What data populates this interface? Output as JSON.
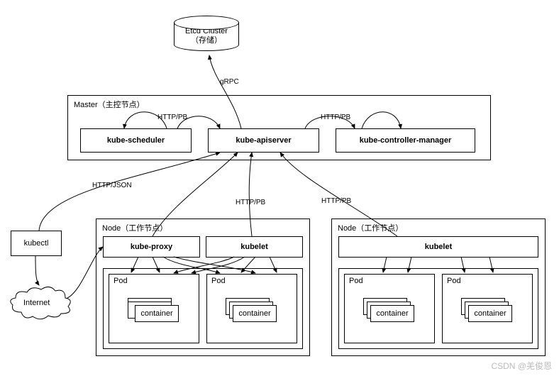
{
  "etcd": {
    "line1": "Etcd Cluster",
    "line2": "（存储）"
  },
  "master": {
    "title": "Master（主控节点）",
    "scheduler": "kube-scheduler",
    "apiserver": "kube-apiserver",
    "controller": "kube-controller-manager"
  },
  "edges": {
    "grpc": "gRPC",
    "httppb": "HTTP/PB",
    "httpjson": "HTTP/JSON"
  },
  "kubectl": "kubectl",
  "internet": "Internet",
  "node1": {
    "title": "Node（工作节点）",
    "proxy": "kube-proxy",
    "kubelet": "kubelet",
    "pod": "Pod",
    "container": "container"
  },
  "node2": {
    "title": "Node（工作节点）",
    "kubelet": "kubelet",
    "pod": "Pod",
    "container": "container"
  },
  "watermark": "CSDN @羌俊恩"
}
